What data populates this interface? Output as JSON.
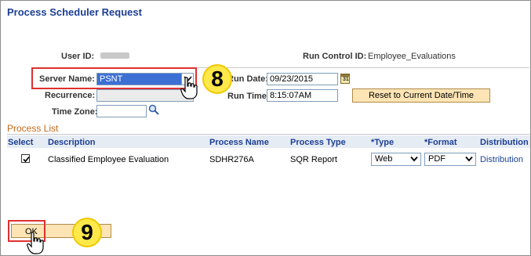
{
  "page": {
    "title": "Process Scheduler Request"
  },
  "header": {
    "user_id_label": "User ID:",
    "run_control_label": "Run Control ID:",
    "run_control_value": "Employee_Evaluations"
  },
  "form": {
    "server_name_label": "Server Name:",
    "server_name_value": "PSNT",
    "run_date_label": "Run Date:",
    "run_date_value": "09/23/2015",
    "recurrence_label": "Recurrence:",
    "recurrence_value": "",
    "run_time_label": "Run Time:",
    "run_time_value": "8:15:07AM",
    "time_zone_label": "Time Zone:",
    "time_zone_value": "",
    "reset_button_label": "Reset to Current Date/Time",
    "calendar_icon_text": "31"
  },
  "process_list": {
    "title": "Process List",
    "columns": [
      "Select",
      "Description",
      "Process Name",
      "Process Type",
      "*Type",
      "*Format",
      "Distribution"
    ],
    "rows": [
      {
        "selected": true,
        "description": "Classified Employee Evaluation",
        "process_name": "SDHR276A",
        "process_type": "SQR Report",
        "type": "Web",
        "format": "PDF",
        "distribution": "Distribution"
      }
    ]
  },
  "footer": {
    "ok_label": "OK"
  },
  "callouts": {
    "step8": "8",
    "step9": "9"
  },
  "icons": {
    "lookup": "magnifier-icon",
    "calendar": "calendar-icon",
    "cursor": "hand-pointer-icon"
  },
  "colors": {
    "title_blue": "#1c3f94",
    "section_orange": "#c56a1a",
    "highlight_red": "#e03030",
    "callout_yellow": "#ffe84a",
    "button_tan": "#fde4b5",
    "selected_blue": "#3b6fd4"
  }
}
